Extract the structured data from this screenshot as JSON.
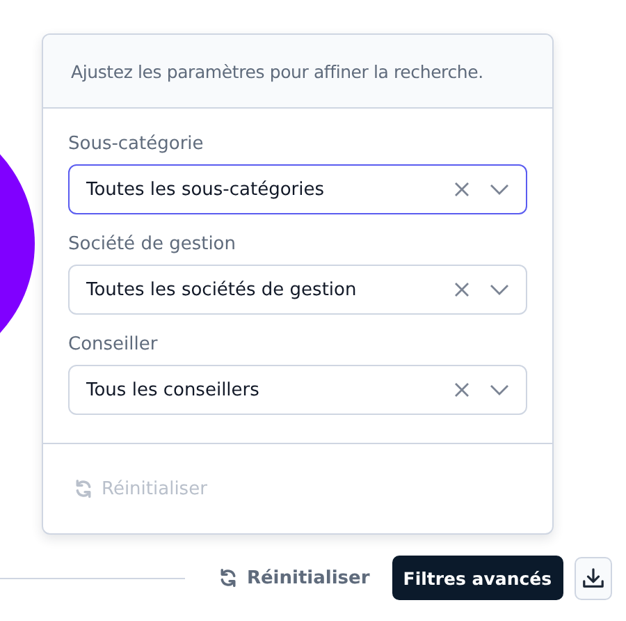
{
  "panel": {
    "description": "Ajustez les paramètres pour affiner la recherche.",
    "filters": [
      {
        "label": "Sous-catégorie",
        "value": "Toutes les sous-catégories",
        "focused": true
      },
      {
        "label": "Société de gestion",
        "value": "Toutes les sociétés de gestion",
        "focused": false
      },
      {
        "label": "Conseiller",
        "value": "Tous les conseillers",
        "focused": false
      }
    ],
    "reset": {
      "label": "Réinitialiser",
      "disabled": true
    }
  },
  "toolbar": {
    "reset": {
      "label": "Réinitialiser",
      "disabled": false
    },
    "advanced_filters": {
      "label": "Filtres avancés"
    }
  }
}
